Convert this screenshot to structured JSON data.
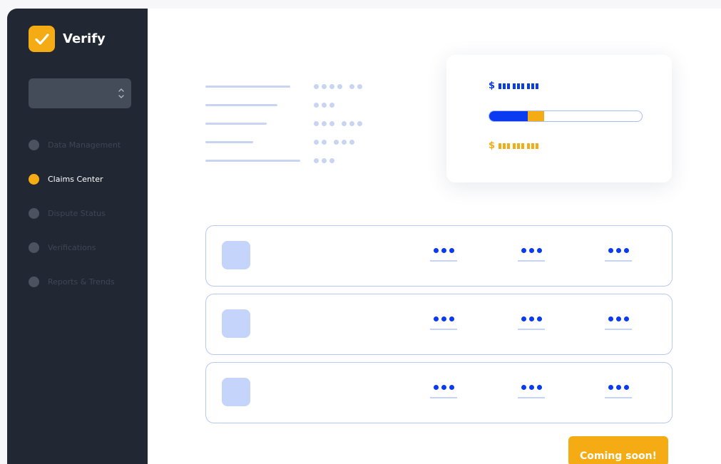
{
  "app": {
    "name": "Verify",
    "brand_color": "#f5ac14",
    "sidebar_color": "#222833",
    "accent_blue": "#0b3bf0"
  },
  "sidebar": {
    "select": {
      "value": ""
    },
    "items": [
      {
        "label": "Data Management",
        "active": false
      },
      {
        "label": "Claims Center",
        "active": true
      },
      {
        "label": "Dispute Status",
        "active": false
      },
      {
        "label": "Verifications",
        "active": false
      },
      {
        "label": "Reports & Trends",
        "active": false
      }
    ]
  },
  "summary_card": {
    "top_currency": "$",
    "bottom_currency": "$",
    "progress": {
      "blue_fraction": 0.25,
      "gold_fraction": 0.11
    }
  },
  "cta": {
    "label": "Coming soon!"
  }
}
